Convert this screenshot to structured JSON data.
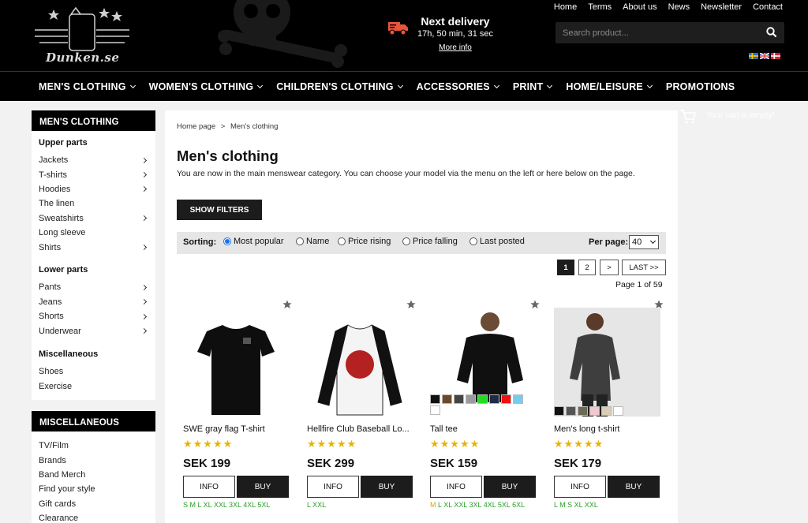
{
  "header": {
    "logo_text": "Dunken.se",
    "delivery": {
      "title": "Next delivery",
      "time": "17h, 50 min, 31 sec",
      "more": "More info"
    },
    "top_links": [
      "Home",
      "Terms",
      "About us",
      "News",
      "Newsletter",
      "Contact"
    ],
    "search": {
      "placeholder": "Search product..."
    },
    "flags": [
      "sweden-flag-icon",
      "uk-flag-icon",
      "denmark-flag-icon"
    ]
  },
  "nav": {
    "items": [
      {
        "label": "MEN'S CLOTHING",
        "dropdown": true
      },
      {
        "label": "WOMEN'S CLOTHING",
        "dropdown": true
      },
      {
        "label": "CHILDREN'S CLOTHING",
        "dropdown": true
      },
      {
        "label": "ACCESSORIES",
        "dropdown": true
      },
      {
        "label": "PRINT",
        "dropdown": true
      },
      {
        "label": "HOME/LEISURE",
        "dropdown": true
      },
      {
        "label": "PROMOTIONS",
        "dropdown": false
      }
    ]
  },
  "sidebar": {
    "title": "MEN'S CLOTHING",
    "upper": {
      "label": "Upper parts",
      "items": [
        {
          "label": "Jackets",
          "arrow": true
        },
        {
          "label": "T-shirts",
          "arrow": true
        },
        {
          "label": "Hoodies",
          "arrow": true
        },
        {
          "label": "The linen",
          "arrow": false
        },
        {
          "label": "Sweatshirts",
          "arrow": true
        },
        {
          "label": "Long sleeve",
          "arrow": false
        },
        {
          "label": "Shirts",
          "arrow": true
        }
      ]
    },
    "lower": {
      "label": "Lower parts",
      "items": [
        {
          "label": "Pants",
          "arrow": true
        },
        {
          "label": "Jeans",
          "arrow": true
        },
        {
          "label": "Shorts",
          "arrow": true
        },
        {
          "label": "Underwear",
          "arrow": true
        }
      ]
    },
    "misc": {
      "label": "Miscellaneous",
      "items": [
        {
          "label": "Shoes",
          "arrow": false
        },
        {
          "label": "Exercise",
          "arrow": false
        }
      ]
    },
    "misc_box": {
      "title": "MISCELLANEOUS",
      "items": [
        "TV/Film",
        "Brands",
        "Band Merch",
        "Find your style",
        "Gift cards",
        "Clearance"
      ]
    }
  },
  "main": {
    "breadcrumb": {
      "home": "Home page",
      "sep": ">",
      "current": "Men's clothing"
    },
    "title": "Men's clothing",
    "intro": "You are now in the main menswear category. You can choose your model via the menu on the left or here below on the page.",
    "show_filters": "SHOW FILTERS",
    "sorting": {
      "label": "Sorting:",
      "options": [
        "Most popular",
        "Name",
        "Price rising",
        "Price falling",
        "Last posted"
      ],
      "selected": "Most popular"
    },
    "per_page": {
      "label": "Per page:",
      "value": "40"
    },
    "pagination": {
      "pages": [
        "1",
        "2",
        ">",
        "LAST >>"
      ],
      "current": "1",
      "summary": "Page 1 of 59"
    }
  },
  "products": [
    {
      "name": "SWE gray flag T-shirt",
      "price": "SEK 199",
      "rating": 5,
      "sizes": "S M L XL XXL 3XL 4XL 5XL",
      "info": "INFO",
      "buy": "BUY",
      "colors": []
    },
    {
      "name": "Hellfire Club Baseball Lo...",
      "price": "SEK 299",
      "rating": 5,
      "sizes": "L XXL",
      "info": "INFO",
      "buy": "BUY",
      "colors": []
    },
    {
      "name": "Tall tee",
      "price": "SEK 159",
      "rating": 5,
      "sizes": "M L XL XXL 3XL 4XL 5XL 6XL",
      "sizes_dim": "M",
      "info": "INFO",
      "buy": "BUY",
      "colors": [
        "#111111",
        "#6b4a2a",
        "#444444",
        "#9a9a9a",
        "#22dd22",
        "#1f2a44",
        "#ee1111",
        "#77ccee",
        "#ffffff"
      ]
    },
    {
      "name": "Men's long t-shirt",
      "price": "SEK 179",
      "rating": 5,
      "sizes": "L M S XL XXL",
      "info": "INFO",
      "buy": "BUY",
      "colors": [
        "#111111",
        "#555555",
        "#6b6b55",
        "#f0c8d0",
        "#d9cdb8",
        "#ffffff"
      ]
    }
  ],
  "cart": {
    "text": "Your cart is empty!"
  },
  "colors": {
    "accent_rating": "#e8b400",
    "sizes_green": "#2a9d2a",
    "delivery_truck": "#e8553a"
  }
}
